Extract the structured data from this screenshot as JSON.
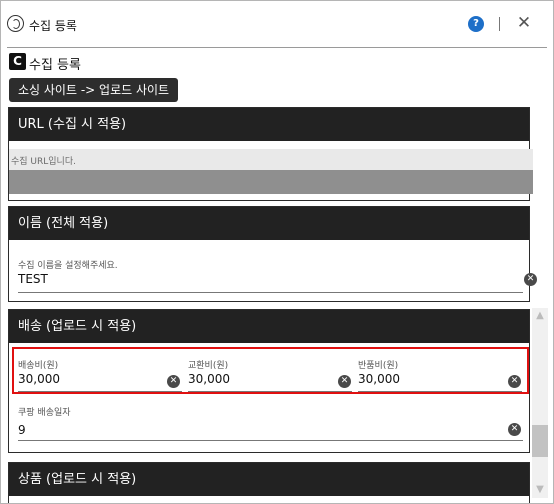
{
  "window": {
    "title": "수집 등록",
    "help_icon": "question-circle-icon",
    "help_label": "?",
    "close_glyph": "✕"
  },
  "brand": {
    "badge": "C",
    "label": "수집 등록"
  },
  "route_chip": "소싱 사이트 -> 업로드 사이트",
  "sections": {
    "url": {
      "title": "URL (수집 시 적용)",
      "label": "수집 URL입니다."
    },
    "name": {
      "title": "이름 (전체 적용)",
      "label": "수집 이름을 설정해주세요.",
      "value": "TEST"
    },
    "shipping": {
      "title": "배송 (업로드 시 적용)",
      "fields": [
        {
          "label": "배송비(원)",
          "value": "30,000"
        },
        {
          "label": "교환비(원)",
          "value": "30,000"
        },
        {
          "label": "반품비(원)",
          "value": "30,000"
        }
      ],
      "coupang_days": {
        "label": "쿠팡 배송일자",
        "value": "9"
      }
    },
    "product": {
      "title": "상품 (업로드 시 적용)"
    }
  },
  "clear_glyph": "✕",
  "colors": {
    "header_bg": "#222222",
    "highlight": "#e01010",
    "help_blue": "#1e6fc8"
  }
}
